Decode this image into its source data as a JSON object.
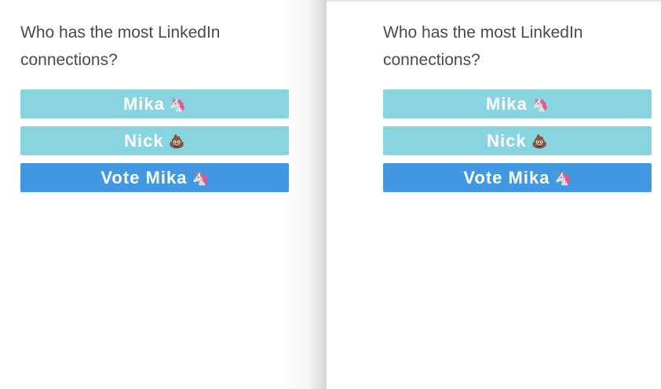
{
  "left_panel": {
    "question": "Who has the most LinkedIn connections?",
    "options": [
      {
        "label": "Mika",
        "emoji": "🦄",
        "icon": "unicorn-icon"
      },
      {
        "label": "Nick",
        "emoji": "💩",
        "icon": "poop-icon"
      }
    ],
    "vote_button": {
      "label": "Vote Mika",
      "emoji": "🦄",
      "icon": "unicorn-icon"
    }
  },
  "right_panel": {
    "question": "Who has the most LinkedIn connections?",
    "options": [
      {
        "label": "Mika",
        "emoji": "🦄",
        "icon": "unicorn-icon"
      },
      {
        "label": "Nick",
        "emoji": "💩",
        "icon": "poop-icon"
      }
    ],
    "vote_button": {
      "label": "Vote Mika",
      "emoji": "🦄",
      "icon": "unicorn-icon"
    }
  },
  "colors": {
    "option_button": "#88d5e1",
    "vote_button": "#4299e1",
    "question_text": "#4a4a4a"
  }
}
